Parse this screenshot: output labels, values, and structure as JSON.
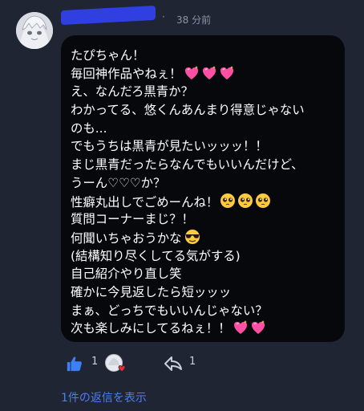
{
  "post": {
    "time_ago": "38 分前",
    "separator": "·",
    "lines": [
      {
        "text": "たぴちゃん！",
        "emoji": []
      },
      {
        "text": "毎回神作品やねぇ！",
        "emoji": [
          "sparkling-heart",
          "sparkling-heart",
          "sparkling-heart"
        ]
      },
      {
        "text": "え、なんだろ黒青か？",
        "emoji": []
      },
      {
        "text": "わかってる、悠くんあんまり得意じゃない",
        "emoji": []
      },
      {
        "text": "のも...",
        "emoji": []
      },
      {
        "text": "でもうちは黒青が見たいッッッ！！",
        "emoji": []
      },
      {
        "text": "まじ黒青だったらなんでもいいんだけど、",
        "emoji": []
      },
      {
        "text": "うーん♡♡♡か？",
        "emoji": []
      },
      {
        "text": "性癖丸出しでごめーんね！",
        "emoji": [
          "pleading-face",
          "pleading-face",
          "pleading-face"
        ]
      },
      {
        "text": "質問コーナーまじ？！",
        "emoji": []
      },
      {
        "text": "何聞いちゃおうかな",
        "emoji": [
          "sunglasses-face"
        ]
      },
      {
        "text": "(結構知り尽くしてる気がする)",
        "emoji": []
      },
      {
        "text": "自己紹介やり直し笑",
        "emoji": []
      },
      {
        "text": "確かに今見返したら短ッッッ",
        "emoji": []
      },
      {
        "text": "まぁ、どっちでもいいんじゃない？",
        "emoji": []
      },
      {
        "text": "次も楽しみにしてるねぇ！！",
        "emoji": [
          "sparkling-heart",
          "sparkling-heart"
        ]
      }
    ]
  },
  "actions": {
    "like_count": "1",
    "retweet_count": "1",
    "like_icon": "thumbs-up-icon",
    "retweet_icon": "retweet-icon"
  },
  "replies_link": "1件の返信を表示",
  "colors": {
    "background": "#1f2533",
    "bubble": "#06080c",
    "accent": "#4d7df5",
    "redaction": "#2f3fe0"
  }
}
